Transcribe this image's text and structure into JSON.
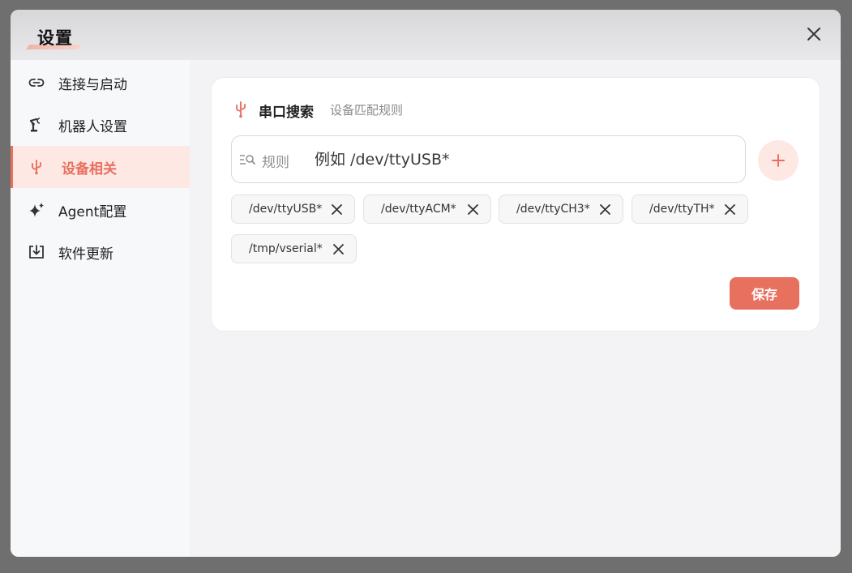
{
  "dialog": {
    "title": "设置"
  },
  "sidebar": {
    "items": [
      {
        "label": "连接与启动",
        "icon": "link-icon",
        "active": false
      },
      {
        "label": "机器人设置",
        "icon": "robot-arm-icon",
        "active": false
      },
      {
        "label": "设备相关",
        "icon": "usb-icon",
        "active": true
      },
      {
        "label": "Agent配置",
        "icon": "sparkle-icon",
        "active": false
      },
      {
        "label": "软件更新",
        "icon": "download-icon",
        "active": false
      }
    ]
  },
  "card": {
    "title": "串口搜索",
    "subtitle": "设备匹配规则",
    "input_label": "规则",
    "input_placeholder": "例如 /dev/ttyUSB*",
    "tags": [
      "/dev/ttyUSB*",
      "/dev/ttyACM*",
      "/dev/ttyCH3*",
      "/dev/ttyTH*",
      "/tmp/vserial*"
    ],
    "save_label": "保存"
  },
  "colors": {
    "accent": "#e8705f",
    "accent_light": "#fde8e4"
  }
}
